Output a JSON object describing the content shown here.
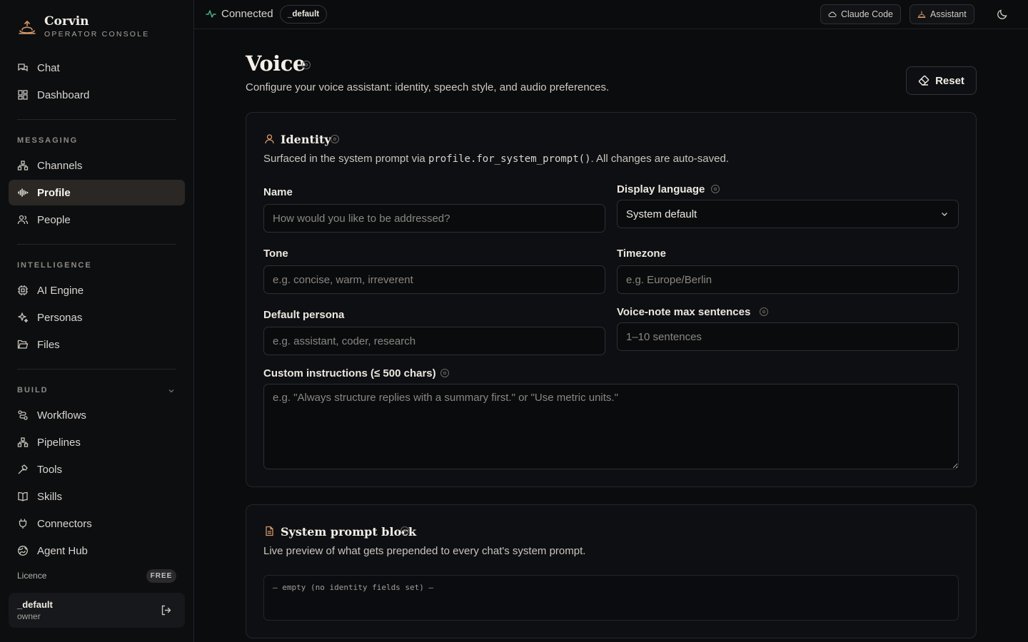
{
  "brand": {
    "name": "Corvin",
    "subtitle": "OPERATOR CONSOLE"
  },
  "sidebar": {
    "top_items": [
      {
        "label": "Chat",
        "icon": "chat-icon"
      },
      {
        "label": "Dashboard",
        "icon": "dashboard-icon"
      }
    ],
    "sections": [
      {
        "label": "MESSAGING",
        "items": [
          {
            "label": "Channels",
            "icon": "channels-icon"
          },
          {
            "label": "Profile",
            "icon": "waveform-icon",
            "active": true
          },
          {
            "label": "People",
            "icon": "people-icon"
          }
        ]
      },
      {
        "label": "INTELLIGENCE",
        "items": [
          {
            "label": "AI Engine",
            "icon": "cpu-icon"
          },
          {
            "label": "Personas",
            "icon": "sparkles-icon"
          },
          {
            "label": "Files",
            "icon": "folder-icon"
          }
        ]
      },
      {
        "label": "BUILD",
        "collapsible": true,
        "items": [
          {
            "label": "Workflows",
            "icon": "workflow-icon"
          },
          {
            "label": "Pipelines",
            "icon": "pipeline-icon"
          },
          {
            "label": "Tools",
            "icon": "hammer-icon"
          },
          {
            "label": "Skills",
            "icon": "book-icon"
          },
          {
            "label": "Connectors",
            "icon": "plug-icon"
          },
          {
            "label": "Agent Hub",
            "icon": "globe-icon"
          }
        ]
      }
    ],
    "licence_label": "Licence",
    "licence_badge": "FREE",
    "user": {
      "name": "_default",
      "role": "owner"
    }
  },
  "topbar": {
    "status": "Connected",
    "workspace": "_default",
    "claude_code": "Claude Code",
    "assistant": "Assistant"
  },
  "page": {
    "title": "Voice",
    "subtitle": "Configure your voice assistant: identity, speech style, and audio preferences.",
    "reset_label": "Reset"
  },
  "identity": {
    "title": "Identity",
    "desc_pre": "Surfaced in the system prompt via ",
    "desc_code": "profile.for_system_prompt()",
    "desc_post": ". All changes are auto-saved.",
    "name_label": "Name",
    "name_placeholder": "How would you like to be addressed?",
    "language_label": "Display language",
    "language_value": "System default",
    "tone_label": "Tone",
    "tone_placeholder": "e.g. concise, warm, irreverent",
    "timezone_label": "Timezone",
    "timezone_placeholder": "e.g. Europe/Berlin",
    "persona_label": "Default persona",
    "persona_placeholder": "e.g. assistant, coder, research",
    "voicenote_label": "Voice-note max sentences",
    "voicenote_placeholder": "1–10 sentences",
    "custom_label": "Custom instructions (≤ 500 chars)",
    "custom_placeholder": "e.g. \"Always structure replies with a summary first.\" or \"Use metric units.\""
  },
  "prompt_block": {
    "title": "System prompt block",
    "desc": "Live preview of what gets prepended to every chat's system prompt.",
    "preview": "— empty (no identity fields set) —"
  },
  "colors": {
    "accent": "#d49a6a",
    "connected": "#4fb58a",
    "background": "#0b0c0e"
  }
}
